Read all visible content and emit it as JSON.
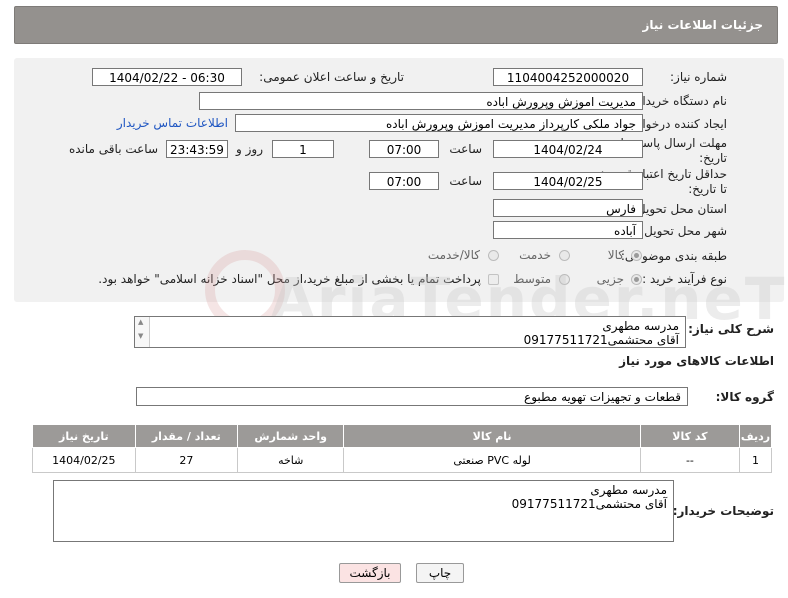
{
  "header": {
    "title": "جزئیات اطلاعات نیاز"
  },
  "form": {
    "need_number_label": "شماره نیاز:",
    "need_number": "1104004252000020",
    "announce_label": "تاریخ و ساعت اعلان عمومی:",
    "announce_value": "1404/02/22 - 06:30",
    "buyer_org_label": "نام دستگاه خریدار:",
    "buyer_org": "مدیریت اموزش وپرورش اباده",
    "requester_label": "ایجاد کننده درخواست:",
    "requester": "جواد ملکی کارپرداز مدیریت اموزش وپرورش اباده",
    "contact_link": "اطلاعات تماس خریدار",
    "deadline_label_1": "مهلت ارسال پاسخ: تا",
    "deadline_label_2": "تاریخ:",
    "deadline_date": "1404/02/24",
    "time_label": "ساعت",
    "deadline_time": "07:00",
    "days_value": "1",
    "days_label": "روز و",
    "remaining_time": "23:43:59",
    "remaining_label": "ساعت باقی مانده",
    "validity_label_1": "حداقل تاریخ اعتبار قیمت:",
    "validity_label_2": "تا تاریخ:",
    "validity_date": "1404/02/25",
    "validity_time": "07:00",
    "province_label": "استان محل تحویل:",
    "province": "فارس",
    "city_label": "شهر محل تحویل:",
    "city": "آباده",
    "category_label": "طبقه بندی موضوعی:",
    "category_options": [
      "کالا",
      "خدمت",
      "کالا/خدمت"
    ],
    "category_selected": "کالا",
    "process_label": "نوع فرآیند خرید :",
    "process_options": [
      "جزیی",
      "متوسط"
    ],
    "process_selected": "جزیی",
    "payment_note": "پرداخت تمام یا بخشی از مبلغ خرید،از محل \"اسناد خزانه اسلامی\" خواهد بود."
  },
  "description": {
    "label": "شرح کلی نیاز:",
    "text": "مدرسه مطهری\nآقای محتشمی09177511721"
  },
  "goods": {
    "section_title": "اطلاعات کالاهای مورد نیاز",
    "group_label": "گروه کالا:",
    "group_value": "قطعات و تجهیزات تهویه مطبوع",
    "columns": [
      "ردیف",
      "کد کالا",
      "نام کالا",
      "واحد شمارش",
      "تعداد / مقدار",
      "تاریخ نیاز"
    ],
    "rows": [
      {
        "row": "1",
        "code": "--",
        "name": "لوله PVC صنعتی",
        "unit": "شاخه",
        "qty": "27",
        "date": "1404/02/25"
      }
    ]
  },
  "buyer_notes": {
    "label": "توضیحات خریدار:",
    "text": "مدرسه مطهری\nآقای محتشمی09177511721"
  },
  "buttons": {
    "print": "چاپ",
    "back": "بازگشت"
  },
  "watermark": "AriaTender.neT",
  "colors": {
    "header_bg": "#94918e",
    "table_header_bg": "#9c9a98",
    "link": "#1f56c2",
    "back_button_bg": "#fbe3e3"
  }
}
